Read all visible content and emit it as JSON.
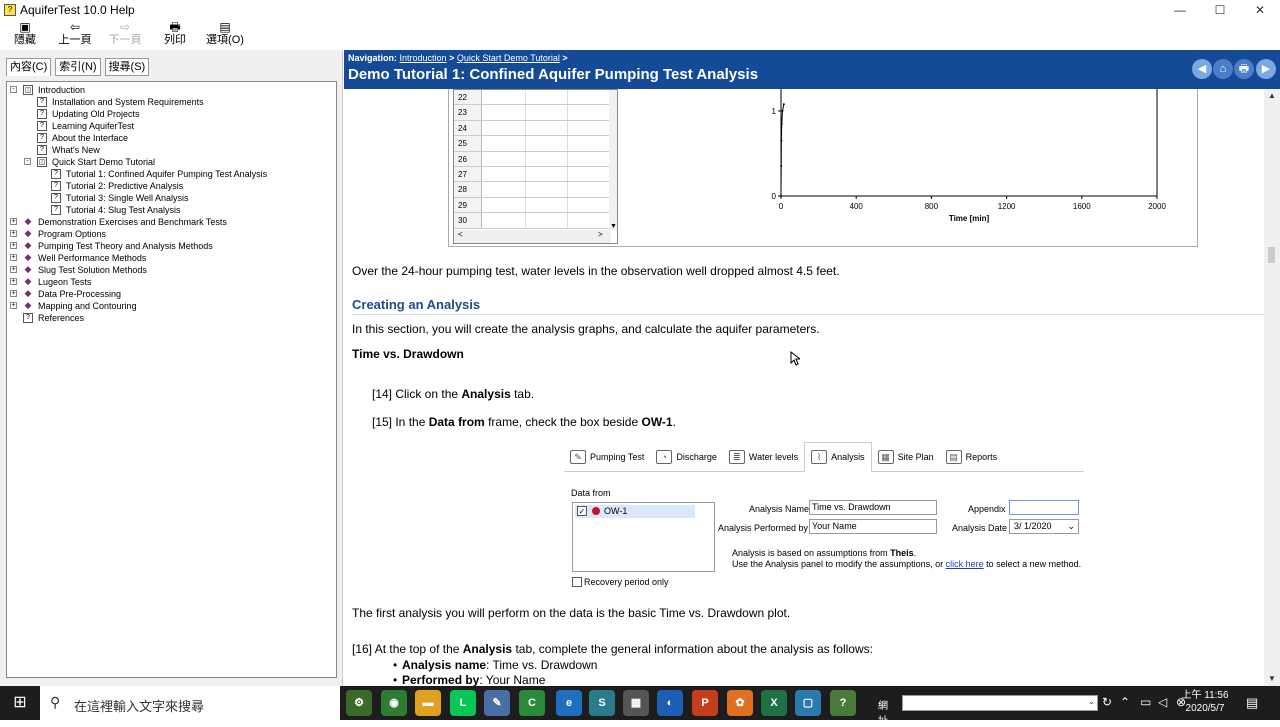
{
  "window": {
    "title": "AquiferTest 10.0 Help",
    "minimize": "—",
    "maximize": "☐",
    "close": "✕"
  },
  "toolbar": [
    {
      "icon": "▣",
      "label": "隱藏"
    },
    {
      "icon": "⇦",
      "label": "上一頁"
    },
    {
      "icon": "⇨",
      "label": "下一頁"
    },
    {
      "icon": "🖶",
      "label": "列印"
    },
    {
      "icon": "▤",
      "label": "選項(O)"
    }
  ],
  "left_tabs": [
    "內容(C)",
    "索引(N)",
    "搜尋(S)"
  ],
  "tree": [
    {
      "label": "Introduction",
      "level": 0,
      "icon": "open",
      "exp": "-"
    },
    {
      "label": "Installation and System Requirements",
      "level": 1,
      "icon": "page"
    },
    {
      "label": "Updating Old Projects",
      "level": 1,
      "icon": "page"
    },
    {
      "label": "Learning AquiferTest",
      "level": 1,
      "icon": "page"
    },
    {
      "label": "About the Interface",
      "level": 1,
      "icon": "page"
    },
    {
      "label": "What's New",
      "level": 1,
      "icon": "page"
    },
    {
      "label": "Quick Start Demo Tutorial",
      "level": 1,
      "icon": "open",
      "exp": "-"
    },
    {
      "label": "Tutorial 1: Confined Aquifer Pumping Test Analysis",
      "level": 2,
      "icon": "page",
      "selected": true
    },
    {
      "label": "Tutorial 2: Predictive Analysis",
      "level": 2,
      "icon": "page"
    },
    {
      "label": "Tutorial 3: Single Well Analysis",
      "level": 2,
      "icon": "page"
    },
    {
      "label": "Tutorial 4: Slug Test Analysis",
      "level": 2,
      "icon": "page"
    },
    {
      "label": "Demonstration Exercises and Benchmark Tests",
      "level": 0,
      "icon": "book",
      "exp": "+"
    },
    {
      "label": "Program Options",
      "level": 0,
      "icon": "book",
      "exp": "+"
    },
    {
      "label": "Pumping Test Theory and Analysis Methods",
      "level": 0,
      "icon": "book",
      "exp": "+"
    },
    {
      "label": "Well Performance Methods",
      "level": 0,
      "icon": "book",
      "exp": "+"
    },
    {
      "label": "Slug Test Solution Methods",
      "level": 0,
      "icon": "book",
      "exp": "+"
    },
    {
      "label": "Lugeon Tests",
      "level": 0,
      "icon": "book",
      "exp": "+"
    },
    {
      "label": "Data Pre-Processing",
      "level": 0,
      "icon": "book",
      "exp": "+"
    },
    {
      "label": "Mapping and Contouring",
      "level": 0,
      "icon": "book",
      "exp": "+"
    },
    {
      "label": "References",
      "level": 0,
      "icon": "page"
    }
  ],
  "nav": {
    "prefix": "Navigation:",
    "crumb1": "Introduction",
    "sep1": ">",
    "crumb2": "Quick Start Demo Tutorial",
    "sep2": ">",
    "title": "Demo Tutorial 1: Confined Aquifer Pumping Test Analysis",
    "buttons": [
      "◀",
      "⌂",
      "🖶",
      "▶"
    ]
  },
  "figure": {
    "rows": [
      "22",
      "23",
      "24",
      "25",
      "26",
      "27",
      "28",
      "29",
      "30"
    ],
    "x_ticks": [
      "0",
      "400",
      "800",
      "1200",
      "1600",
      "2000"
    ],
    "y_ticks": [
      "1",
      "0"
    ],
    "xlabel": "Time [min]"
  },
  "chart_data": {
    "type": "line",
    "xlabel": "Time [min]",
    "ylabel": "",
    "xlim": [
      0,
      2000
    ],
    "x_ticks": [
      0,
      400,
      800,
      1200,
      1600,
      2000
    ],
    "y_ticks": [
      0,
      1
    ],
    "series": [
      {
        "x": [
          0,
          1,
          2,
          4,
          8,
          15
        ],
        "y": [
          0,
          0.35,
          0.65,
          0.85,
          1.0,
          1.08
        ]
      }
    ]
  },
  "body": {
    "p1": "Over the 24-hour pumping test, water levels in the observation well dropped almost 4.5 feet.",
    "h_creating": "Creating an Analysis",
    "p2": "In this section, you will create the analysis graphs, and calculate the aquifer parameters.",
    "h_time": "Time vs. Drawdown",
    "s14_pre": "[14] Click on the ",
    "s14_b": "Analysis",
    "s14_post": " tab.",
    "s15_pre": "[15] In the ",
    "s15_b1": "Data from",
    "s15_mid": " frame, check the box beside ",
    "s15_b2": "OW-1",
    "s15_post": ".",
    "p3": "The first analysis you will perform on the data is the basic Time vs. Drawdown plot.",
    "s16_pre": "[16] At the top of the ",
    "s16_b": "Analysis",
    "s16_post": " tab, complete the general information about the analysis as follows:",
    "b1_label": "Analysis name",
    "b1_val": ": Time vs. Drawdown",
    "b2_label": "Performed by",
    "b2_val": ": Your Name"
  },
  "shot": {
    "tabs": [
      {
        "label": "Pumping Test",
        "icon": "✎"
      },
      {
        "label": "Discharge",
        "icon": "◔"
      },
      {
        "label": "Water levels",
        "icon": "≣"
      },
      {
        "label": "Analysis",
        "icon": "⌇",
        "active": true
      },
      {
        "label": "Site Plan",
        "icon": "▦"
      },
      {
        "label": "Reports",
        "icon": "▤"
      }
    ],
    "data_from": "Data from",
    "ow": "OW-1",
    "recovery": "Recovery period only",
    "analysis_name_lbl": "Analysis Name",
    "analysis_name_val": "Time vs. Drawdown",
    "performed_lbl": "Analysis Performed by",
    "performed_val": "Your Name",
    "appendix_lbl": "Appendix",
    "date_lbl": "Analysis Date",
    "date_val": "3/  1/2020",
    "note1_pre": "Analysis is based on assumptions from ",
    "note1_b": "Theis",
    "note1_post": ".",
    "note2_pre": "Use the Analysis panel to modify the assumptions, or ",
    "note2_link": "click here",
    "note2_post": " to select a new method."
  },
  "taskbar": {
    "search_placeholder": "在這裡輸入文字來搜尋",
    "addr_label": "網址",
    "time": "上午 11:56",
    "date": "2020/5/7",
    "apps": [
      {
        "name": "aquifertest-app",
        "glyph": "⚙",
        "color": "#3a6a2a"
      },
      {
        "name": "chrome-app",
        "glyph": "◉",
        "color": "#2e7d32"
      },
      {
        "name": "explorer-app",
        "glyph": "▬",
        "color": "#e0a020"
      },
      {
        "name": "line-app",
        "glyph": "L",
        "color": "#06c755"
      },
      {
        "name": "pen-app",
        "glyph": "✎",
        "color": "#4a6fa5"
      },
      {
        "name": "camtasia-app",
        "glyph": "C",
        "color": "#2a8a3a"
      },
      {
        "name": "edge-app",
        "glyph": "e",
        "color": "#1e6fbf"
      },
      {
        "name": "sway-app",
        "glyph": "S",
        "color": "#2a7a8a"
      },
      {
        "name": "calculator-app",
        "glyph": "▦",
        "color": "#555555"
      },
      {
        "name": "browser-app",
        "glyph": "◐",
        "color": "#1a5fb4"
      },
      {
        "name": "powerpoint-app",
        "glyph": "P",
        "color": "#c43e1c"
      },
      {
        "name": "photo-app",
        "glyph": "✿",
        "color": "#e07020"
      },
      {
        "name": "excel-app",
        "glyph": "X",
        "color": "#1e7145"
      },
      {
        "name": "snip-app",
        "glyph": "▢",
        "color": "#2a7ab0"
      },
      {
        "name": "help-app",
        "glyph": "?",
        "color": "#4a7a3a"
      }
    ]
  }
}
